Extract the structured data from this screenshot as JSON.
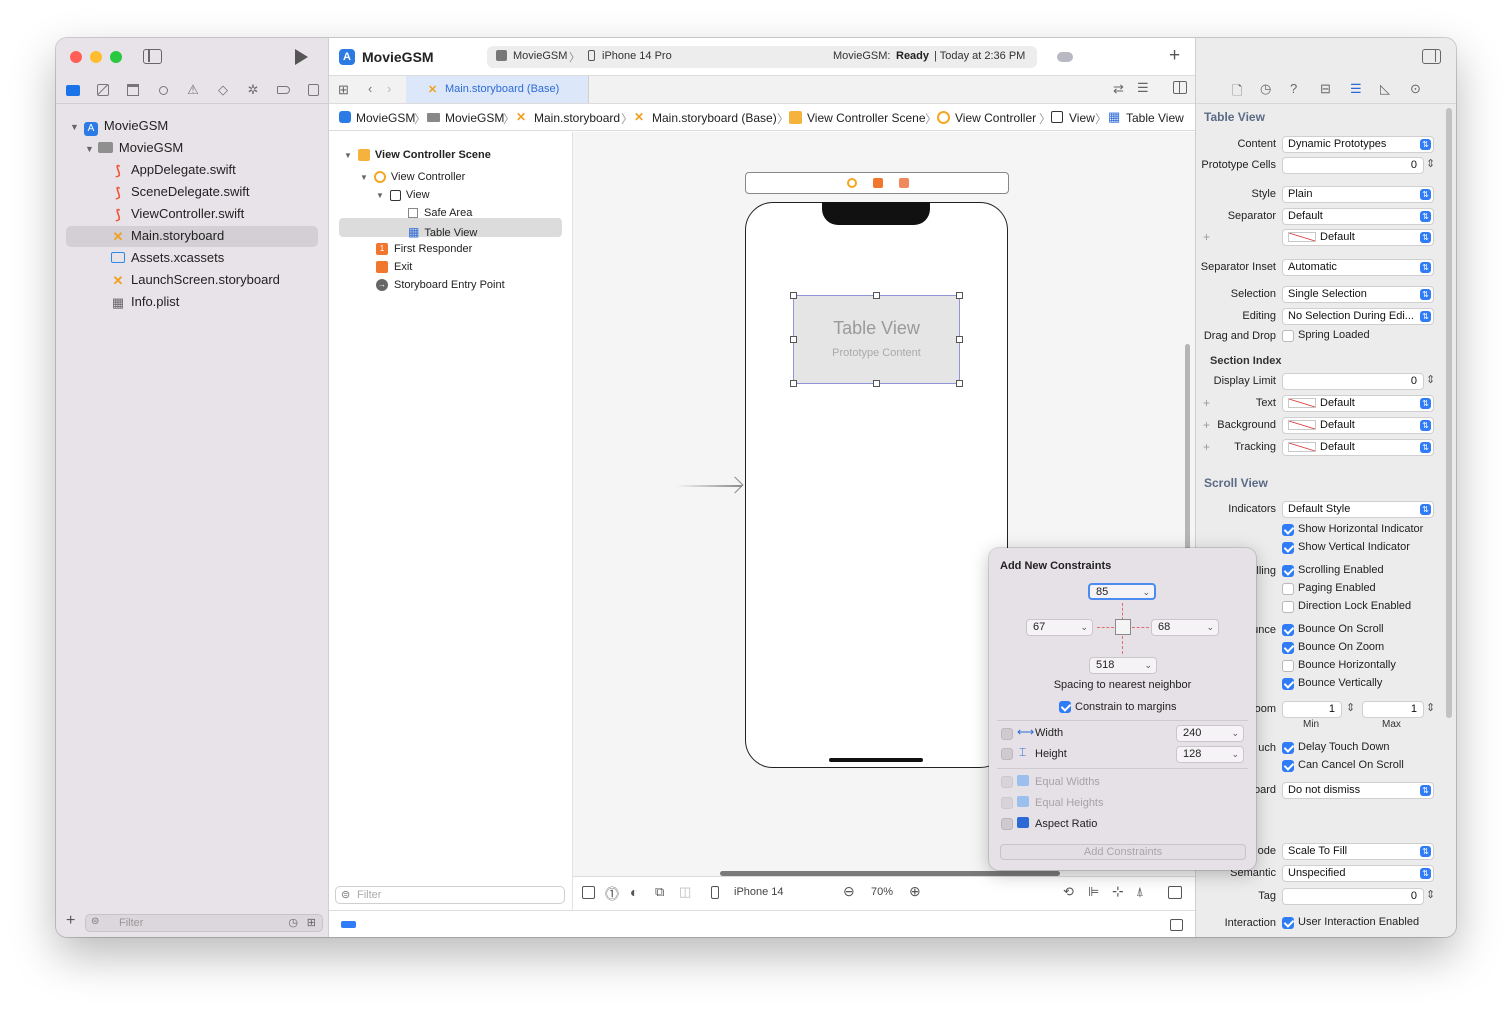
{
  "window": {
    "project_title": "MovieGSM",
    "scheme": "MovieGSM",
    "device": "iPhone 14 Pro",
    "status_project": "MovieGSM:",
    "status_state": "Ready",
    "status_time": "| Today at 2:36 PM"
  },
  "navigator": {
    "items": [
      {
        "label": "MovieGSM",
        "kind": "project"
      },
      {
        "label": "MovieGSM",
        "kind": "folder"
      },
      {
        "label": "AppDelegate.swift",
        "kind": "swift"
      },
      {
        "label": "SceneDelegate.swift",
        "kind": "swift"
      },
      {
        "label": "ViewController.swift",
        "kind": "swift"
      },
      {
        "label": "Main.storyboard",
        "kind": "storyboard"
      },
      {
        "label": "Assets.xcassets",
        "kind": "assets"
      },
      {
        "label": "LaunchScreen.storyboard",
        "kind": "storyboard"
      },
      {
        "label": "Info.plist",
        "kind": "plist"
      }
    ],
    "filter_placeholder": "Filter"
  },
  "tab": {
    "label": "Main.storyboard (Base)"
  },
  "jumpbar": [
    "MovieGSM",
    "MovieGSM",
    "Main.storyboard",
    "Main.storyboard (Base)",
    "View Controller Scene",
    "View Controller",
    "View",
    "Table View"
  ],
  "outline": {
    "items": [
      "View Controller Scene",
      "View Controller",
      "View",
      "Safe Area",
      "Table View",
      "First Responder",
      "Exit",
      "Storyboard Entry Point"
    ],
    "filter_placeholder": "Filter"
  },
  "canvas": {
    "table_title": "Table View",
    "table_subtitle": "Prototype Content"
  },
  "bottombar": {
    "device": "iPhone 14",
    "zoom": "70%"
  },
  "constraints": {
    "title": "Add New Constraints",
    "top": "85",
    "left": "67",
    "right": "68",
    "bottom": "518",
    "spacing_label": "Spacing to nearest neighbor",
    "constrain_margins": "Constrain to margins",
    "width_label": "Width",
    "width_value": "240",
    "height_label": "Height",
    "height_value": "128",
    "equal_widths": "Equal Widths",
    "equal_heights": "Equal Heights",
    "aspect_ratio": "Aspect Ratio",
    "add_button": "Add Constraints"
  },
  "inspector": {
    "table_view_header": "Table View",
    "content_label": "Content",
    "content_value": "Dynamic Prototypes",
    "proto_label": "Prototype Cells",
    "proto_value": "0",
    "style_label": "Style",
    "style_value": "Plain",
    "separator_label": "Separator",
    "separator_value": "Default",
    "separator_color": "Default",
    "inset_label": "Separator Inset",
    "inset_value": "Automatic",
    "selection_label": "Selection",
    "selection_value": "Single Selection",
    "editing_label": "Editing",
    "editing_value": "No Selection During Edi...",
    "drag_label": "Drag and Drop",
    "spring_loaded": "Spring Loaded",
    "section_index": "Section Index",
    "display_limit_label": "Display Limit",
    "display_limit_value": "0",
    "text_label": "Text",
    "text_value": "Default",
    "bg_label": "Background",
    "bg_value": "Default",
    "tracking_label": "Tracking",
    "tracking_value": "Default",
    "scroll_view_header": "Scroll View",
    "indicators_label": "Indicators",
    "indicators_value": "Default Style",
    "show_h": "Show Horizontal Indicator",
    "show_v": "Show Vertical Indicator",
    "scrolling_label": "lling",
    "scrolling_enabled": "Scrolling Enabled",
    "paging_enabled": "Paging Enabled",
    "direction_lock": "Direction Lock Enabled",
    "bounce_label": "unce",
    "bounce_scroll": "Bounce On Scroll",
    "bounce_zoom": "Bounce On Zoom",
    "bounce_h": "Bounce Horizontally",
    "bounce_v": "Bounce Vertically",
    "zoom_label": "oom",
    "zoom_min": "1",
    "zoom_max": "1",
    "min_label": "Min",
    "max_label": "Max",
    "touch_label": "uch",
    "delay_touch": "Delay Touch Down",
    "cancel_scroll": "Can Cancel On Scroll",
    "keyboard_label": "oard",
    "keyboard_value": "Do not dismiss",
    "mode_label": "ode",
    "mode_value": "Scale To Fill",
    "semantic_label": "Semantic",
    "semantic_value": "Unspecified",
    "tag_label": "Tag",
    "tag_value": "0",
    "interaction_label": "Interaction",
    "user_interaction": "User Interaction Enabled"
  }
}
